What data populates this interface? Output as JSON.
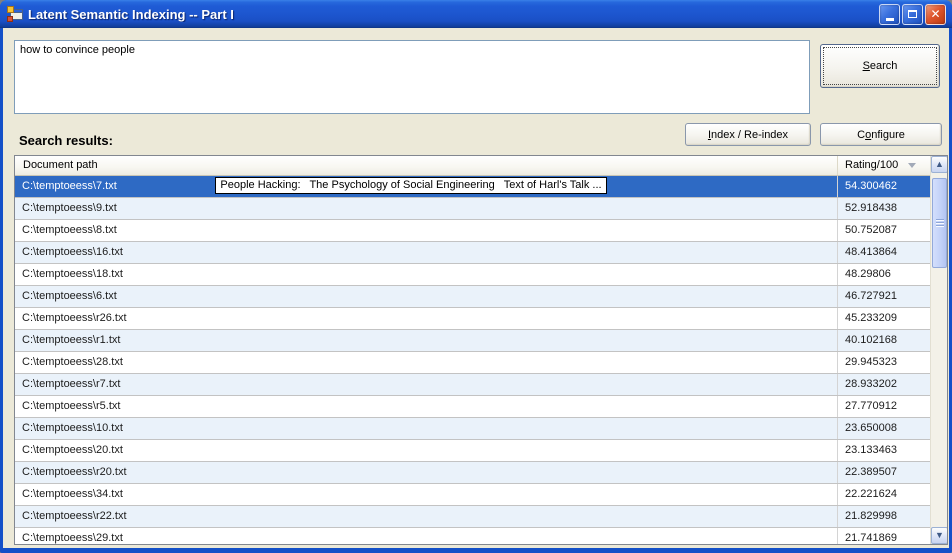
{
  "window": {
    "title": "Latent Semantic Indexing -- Part I"
  },
  "search": {
    "query": "how to convince people",
    "button": {
      "pre": "",
      "key": "S",
      "post": "earch"
    }
  },
  "actions": {
    "index_button": {
      "pre": "",
      "key": "I",
      "post": "ndex / Re-index"
    },
    "configure_button": {
      "pre": "C",
      "key": "o",
      "post": "nfigure"
    }
  },
  "results": {
    "label": "Search results:",
    "columns": [
      {
        "label": "Document path"
      },
      {
        "label": "Rating/100",
        "sort": "desc"
      }
    ],
    "tooltip": "People Hacking:   The Psychology of Social Engineering   Text of Harl's Talk ...",
    "selected_index": 0,
    "rows": [
      {
        "path": "C:\\temptoeess\\7.txt",
        "rating": "54.300462"
      },
      {
        "path": "C:\\temptoeess\\9.txt",
        "rating": "52.918438"
      },
      {
        "path": "C:\\temptoeess\\8.txt",
        "rating": "50.752087"
      },
      {
        "path": "C:\\temptoeess\\16.txt",
        "rating": "48.413864"
      },
      {
        "path": "C:\\temptoeess\\18.txt",
        "rating": "48.29806"
      },
      {
        "path": "C:\\temptoeess\\6.txt",
        "rating": "46.727921"
      },
      {
        "path": "C:\\temptoeess\\r26.txt",
        "rating": "45.233209"
      },
      {
        "path": "C:\\temptoeess\\r1.txt",
        "rating": "40.102168"
      },
      {
        "path": "C:\\temptoeess\\28.txt",
        "rating": "29.945323"
      },
      {
        "path": "C:\\temptoeess\\r7.txt",
        "rating": "28.933202"
      },
      {
        "path": "C:\\temptoeess\\r5.txt",
        "rating": "27.770912"
      },
      {
        "path": "C:\\temptoeess\\10.txt",
        "rating": "23.650008"
      },
      {
        "path": "C:\\temptoeess\\20.txt",
        "rating": "23.133463"
      },
      {
        "path": "C:\\temptoeess\\r20.txt",
        "rating": "22.389507"
      },
      {
        "path": "C:\\temptoeess\\34.txt",
        "rating": "22.221624"
      },
      {
        "path": "C:\\temptoeess\\r22.txt",
        "rating": "21.829998"
      },
      {
        "path": "C:\\temptoeess\\29.txt",
        "rating": "21.741869"
      }
    ]
  },
  "colors": {
    "titlebar_blue": "#1D56CF",
    "selection_blue": "#2E6AC4",
    "alt_row_blue": "#EAF2FA",
    "client_bg": "#ECE9D8"
  }
}
